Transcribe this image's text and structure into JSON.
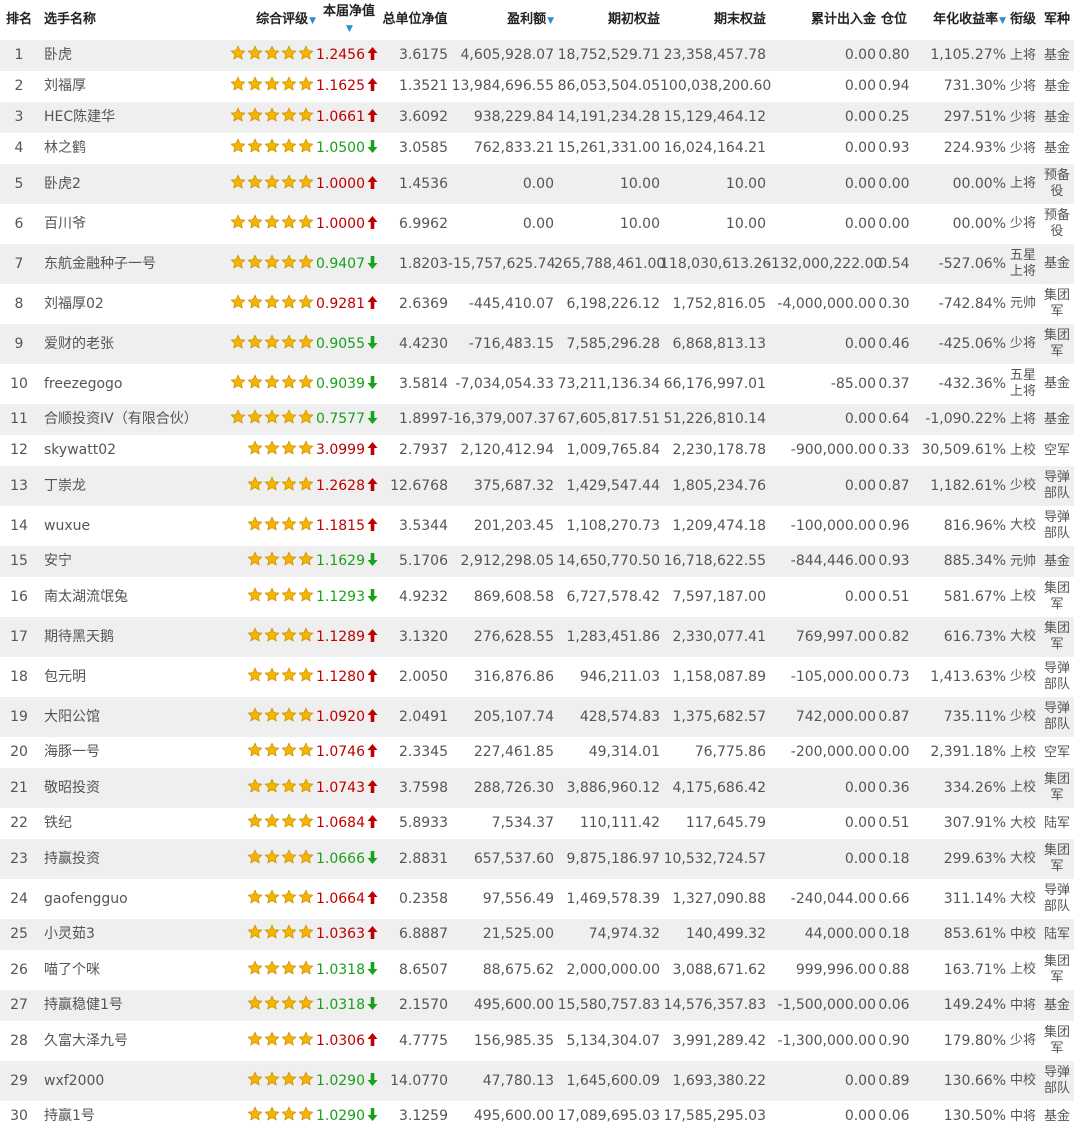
{
  "header": {
    "rank": "排名",
    "name": "选手名称",
    "rating": "综合评级",
    "nav_week": "本届净值",
    "nav_total": "总单位净值",
    "profit": "盈利额",
    "equity_start": "期初权益",
    "equity_end": "期末权益",
    "cum_flow": "累计出入金",
    "position": "仓位",
    "annual_return": "年化收益率",
    "title_rank": "衔级",
    "branch": "军种",
    "sort_icon": "▼"
  },
  "colors": {
    "up": "#c00000",
    "down": "#1aa01a",
    "star": "#f5b400",
    "row_alt": "#efefef"
  },
  "rows": [
    {
      "rank": "1",
      "name": "卧虎",
      "stars": 5,
      "nav": "1.2456",
      "dir": "up",
      "nav_total": "3.6175",
      "profit": "4,605,928.07",
      "start": "18,752,529.71",
      "end": "23,358,457.78",
      "flow": "0.00",
      "pos": "0.80",
      "annual": "1,105.27%",
      "title": "上将",
      "branch": "基金"
    },
    {
      "rank": "2",
      "name": "刘福厚",
      "stars": 5,
      "nav": "1.1625",
      "dir": "up",
      "nav_total": "1.3521",
      "profit": "13,984,696.55",
      "start": "86,053,504.05",
      "end": "100,038,200.60",
      "flow": "0.00",
      "pos": "0.94",
      "annual": "731.30%",
      "title": "少将",
      "branch": "基金"
    },
    {
      "rank": "3",
      "name": "HEC陈建华",
      "stars": 5,
      "nav": "1.0661",
      "dir": "up",
      "nav_total": "3.6092",
      "profit": "938,229.84",
      "start": "14,191,234.28",
      "end": "15,129,464.12",
      "flow": "0.00",
      "pos": "0.25",
      "annual": "297.51%",
      "title": "少将",
      "branch": "基金"
    },
    {
      "rank": "4",
      "name": "林之鹤",
      "stars": 5,
      "nav": "1.0500",
      "dir": "down",
      "nav_total": "3.0585",
      "profit": "762,833.21",
      "start": "15,261,331.00",
      "end": "16,024,164.21",
      "flow": "0.00",
      "pos": "0.93",
      "annual": "224.93%",
      "title": "少将",
      "branch": "基金"
    },
    {
      "rank": "5",
      "name": "卧虎2",
      "stars": 5,
      "nav": "1.0000",
      "dir": "up",
      "nav_total": "1.4536",
      "profit": "0.00",
      "start": "10.00",
      "end": "10.00",
      "flow": "0.00",
      "pos": "0.00",
      "annual": "00.00%",
      "title": "上将",
      "branch": "预备役"
    },
    {
      "rank": "6",
      "name": "百川爷",
      "stars": 5,
      "nav": "1.0000",
      "dir": "up",
      "nav_total": "6.9962",
      "profit": "0.00",
      "start": "10.00",
      "end": "10.00",
      "flow": "0.00",
      "pos": "0.00",
      "annual": "00.00%",
      "title": "少将",
      "branch": "预备役"
    },
    {
      "rank": "7",
      "name": "东航金融种子一号",
      "stars": 5,
      "nav": "0.9407",
      "dir": "down",
      "nav_total": "1.8203",
      "profit": "-15,757,625.74",
      "start": "265,788,461.00",
      "end": "118,030,613.26",
      "flow": "-132,000,222.00",
      "pos": "0.54",
      "annual": "-527.06%",
      "title": "五星上将",
      "branch": "基金"
    },
    {
      "rank": "8",
      "name": "刘福厚02",
      "stars": 5,
      "nav": "0.9281",
      "dir": "up",
      "nav_total": "2.6369",
      "profit": "-445,410.07",
      "start": "6,198,226.12",
      "end": "1,752,816.05",
      "flow": "-4,000,000.00",
      "pos": "0.30",
      "annual": "-742.84%",
      "title": "元帅",
      "branch": "集团军"
    },
    {
      "rank": "9",
      "name": "爱财的老张",
      "stars": 5,
      "nav": "0.9055",
      "dir": "down",
      "nav_total": "4.4230",
      "profit": "-716,483.15",
      "start": "7,585,296.28",
      "end": "6,868,813.13",
      "flow": "0.00",
      "pos": "0.46",
      "annual": "-425.06%",
      "title": "少将",
      "branch": "集团军"
    },
    {
      "rank": "10",
      "name": "freezegogo",
      "stars": 5,
      "nav": "0.9039",
      "dir": "down",
      "nav_total": "3.5814",
      "profit": "-7,034,054.33",
      "start": "73,211,136.34",
      "end": "66,176,997.01",
      "flow": "-85.00",
      "pos": "0.37",
      "annual": "-432.36%",
      "title": "五星上将",
      "branch": "基金"
    },
    {
      "rank": "11",
      "name": "合顺投资IV（有限合伙）",
      "stars": 5,
      "nav": "0.7577",
      "dir": "down",
      "nav_total": "1.8997",
      "profit": "-16,379,007.37",
      "start": "67,605,817.51",
      "end": "51,226,810.14",
      "flow": "0.00",
      "pos": "0.64",
      "annual": "-1,090.22%",
      "title": "上将",
      "branch": "基金"
    },
    {
      "rank": "12",
      "name": "skywatt02",
      "stars": 4,
      "nav": "3.0999",
      "dir": "up",
      "nav_total": "2.7937",
      "profit": "2,120,412.94",
      "start": "1,009,765.84",
      "end": "2,230,178.78",
      "flow": "-900,000.00",
      "pos": "0.33",
      "annual": "30,509.61%",
      "title": "上校",
      "branch": "空军"
    },
    {
      "rank": "13",
      "name": "丁崇龙",
      "stars": 4,
      "nav": "1.2628",
      "dir": "up",
      "nav_total": "12.6768",
      "profit": "375,687.32",
      "start": "1,429,547.44",
      "end": "1,805,234.76",
      "flow": "0.00",
      "pos": "0.87",
      "annual": "1,182.61%",
      "title": "少校",
      "branch": "导弹部队"
    },
    {
      "rank": "14",
      "name": "wuxue",
      "stars": 4,
      "nav": "1.1815",
      "dir": "up",
      "nav_total": "3.5344",
      "profit": "201,203.45",
      "start": "1,108,270.73",
      "end": "1,209,474.18",
      "flow": "-100,000.00",
      "pos": "0.96",
      "annual": "816.96%",
      "title": "大校",
      "branch": "导弹部队"
    },
    {
      "rank": "15",
      "name": "安宁",
      "stars": 4,
      "nav": "1.1629",
      "dir": "down",
      "nav_total": "5.1706",
      "profit": "2,912,298.05",
      "start": "14,650,770.50",
      "end": "16,718,622.55",
      "flow": "-844,446.00",
      "pos": "0.93",
      "annual": "885.34%",
      "title": "元帅",
      "branch": "基金"
    },
    {
      "rank": "16",
      "name": "南太湖流氓兔",
      "stars": 4,
      "nav": "1.1293",
      "dir": "down",
      "nav_total": "4.9232",
      "profit": "869,608.58",
      "start": "6,727,578.42",
      "end": "7,597,187.00",
      "flow": "0.00",
      "pos": "0.51",
      "annual": "581.67%",
      "title": "上校",
      "branch": "集团军"
    },
    {
      "rank": "17",
      "name": "期待黑天鹅",
      "stars": 4,
      "nav": "1.1289",
      "dir": "up",
      "nav_total": "3.1320",
      "profit": "276,628.55",
      "start": "1,283,451.86",
      "end": "2,330,077.41",
      "flow": "769,997.00",
      "pos": "0.82",
      "annual": "616.73%",
      "title": "大校",
      "branch": "集团军"
    },
    {
      "rank": "18",
      "name": "包元明",
      "stars": 4,
      "nav": "1.1280",
      "dir": "up",
      "nav_total": "2.0050",
      "profit": "316,876.86",
      "start": "946,211.03",
      "end": "1,158,087.89",
      "flow": "-105,000.00",
      "pos": "0.73",
      "annual": "1,413.63%",
      "title": "少校",
      "branch": "导弹部队"
    },
    {
      "rank": "19",
      "name": "大阳公馆",
      "stars": 4,
      "nav": "1.0920",
      "dir": "up",
      "nav_total": "2.0491",
      "profit": "205,107.74",
      "start": "428,574.83",
      "end": "1,375,682.57",
      "flow": "742,000.00",
      "pos": "0.87",
      "annual": "735.11%",
      "title": "少校",
      "branch": "导弹部队"
    },
    {
      "rank": "20",
      "name": "海豚一号",
      "stars": 4,
      "nav": "1.0746",
      "dir": "up",
      "nav_total": "2.3345",
      "profit": "227,461.85",
      "start": "49,314.01",
      "end": "76,775.86",
      "flow": "-200,000.00",
      "pos": "0.00",
      "annual": "2,391.18%",
      "title": "上校",
      "branch": "空军"
    },
    {
      "rank": "21",
      "name": "敬昭投资",
      "stars": 4,
      "nav": "1.0743",
      "dir": "up",
      "nav_total": "3.7598",
      "profit": "288,726.30",
      "start": "3,886,960.12",
      "end": "4,175,686.42",
      "flow": "0.00",
      "pos": "0.36",
      "annual": "334.26%",
      "title": "上校",
      "branch": "集团军"
    },
    {
      "rank": "22",
      "name": "铁纪",
      "stars": 4,
      "nav": "1.0684",
      "dir": "up",
      "nav_total": "5.8933",
      "profit": "7,534.37",
      "start": "110,111.42",
      "end": "117,645.79",
      "flow": "0.00",
      "pos": "0.51",
      "annual": "307.91%",
      "title": "大校",
      "branch": "陆军"
    },
    {
      "rank": "23",
      "name": "持赢投资",
      "stars": 4,
      "nav": "1.0666",
      "dir": "down",
      "nav_total": "2.8831",
      "profit": "657,537.60",
      "start": "9,875,186.97",
      "end": "10,532,724.57",
      "flow": "0.00",
      "pos": "0.18",
      "annual": "299.63%",
      "title": "大校",
      "branch": "集团军"
    },
    {
      "rank": "24",
      "name": "gaofengguo",
      "stars": 4,
      "nav": "1.0664",
      "dir": "up",
      "nav_total": "0.2358",
      "profit": "97,556.49",
      "start": "1,469,578.39",
      "end": "1,327,090.88",
      "flow": "-240,044.00",
      "pos": "0.66",
      "annual": "311.14%",
      "title": "大校",
      "branch": "导弹部队"
    },
    {
      "rank": "25",
      "name": "小灵茹3",
      "stars": 4,
      "nav": "1.0363",
      "dir": "up",
      "nav_total": "6.8887",
      "profit": "21,525.00",
      "start": "74,974.32",
      "end": "140,499.32",
      "flow": "44,000.00",
      "pos": "0.18",
      "annual": "853.61%",
      "title": "中校",
      "branch": "陆军"
    },
    {
      "rank": "26",
      "name": "喵了个咪",
      "stars": 4,
      "nav": "1.0318",
      "dir": "down",
      "nav_total": "8.6507",
      "profit": "88,675.62",
      "start": "2,000,000.00",
      "end": "3,088,671.62",
      "flow": "999,996.00",
      "pos": "0.88",
      "annual": "163.71%",
      "title": "上校",
      "branch": "集团军"
    },
    {
      "rank": "27",
      "name": "持赢稳健1号",
      "stars": 4,
      "nav": "1.0318",
      "dir": "down",
      "nav_total": "2.1570",
      "profit": "495,600.00",
      "start": "15,580,757.83",
      "end": "14,576,357.83",
      "flow": "-1,500,000.00",
      "pos": "0.06",
      "annual": "149.24%",
      "title": "中将",
      "branch": "基金"
    },
    {
      "rank": "28",
      "name": "久富大泽九号",
      "stars": 4,
      "nav": "1.0306",
      "dir": "up",
      "nav_total": "4.7775",
      "profit": "156,985.35",
      "start": "5,134,304.07",
      "end": "3,991,289.42",
      "flow": "-1,300,000.00",
      "pos": "0.90",
      "annual": "179.80%",
      "title": "少将",
      "branch": "集团军"
    },
    {
      "rank": "29",
      "name": "wxf2000",
      "stars": 4,
      "nav": "1.0290",
      "dir": "down",
      "nav_total": "14.0770",
      "profit": "47,780.13",
      "start": "1,645,600.09",
      "end": "1,693,380.22",
      "flow": "0.00",
      "pos": "0.89",
      "annual": "130.66%",
      "title": "中校",
      "branch": "导弹部队"
    },
    {
      "rank": "30",
      "name": "持赢1号",
      "stars": 4,
      "nav": "1.0290",
      "dir": "down",
      "nav_total": "3.1259",
      "profit": "495,600.00",
      "start": "17,089,695.03",
      "end": "17,585,295.03",
      "flow": "0.00",
      "pos": "0.06",
      "annual": "130.50%",
      "title": "中将",
      "branch": "基金"
    }
  ]
}
